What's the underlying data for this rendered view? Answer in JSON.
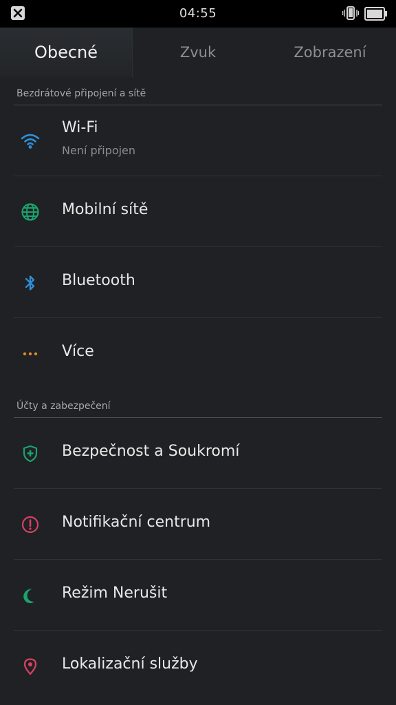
{
  "status_bar": {
    "time": "04:55"
  },
  "tabs": [
    {
      "label": "Obecné",
      "active": true
    },
    {
      "label": "Zvuk",
      "active": false
    },
    {
      "label": "Zobrazení",
      "active": false
    }
  ],
  "sections": [
    {
      "title": "Bezdrátové připojení a sítě",
      "items": [
        {
          "label": "Wi-Fi",
          "sub": "Není připojen",
          "icon": "wifi-icon",
          "color": "#2f8fd8"
        },
        {
          "label": "Mobilní sítě",
          "icon": "globe-icon",
          "color": "#1aa46e"
        },
        {
          "label": "Bluetooth",
          "icon": "bluetooth-icon",
          "color": "#2f8fd8"
        },
        {
          "label": "Více",
          "icon": "more-dots-icon",
          "color": "#e0892a"
        }
      ]
    },
    {
      "title": "Účty a zabezpečení",
      "items": [
        {
          "label": "Bezpečnost a Soukromí",
          "icon": "shield-icon",
          "color": "#1aa46e"
        },
        {
          "label": "Notifikační centrum",
          "icon": "alert-circle-icon",
          "color": "#d84064"
        },
        {
          "label": "Režim Nerušit",
          "icon": "moon-icon",
          "color": "#1aa46e"
        },
        {
          "label": "Lokalizační služby",
          "icon": "location-pin-icon",
          "color": "#d84064"
        }
      ]
    }
  ]
}
